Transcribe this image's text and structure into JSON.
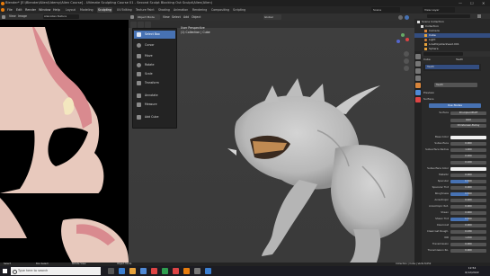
{
  "window": {
    "title": "Blender* [E:\\Blender\\Alien\\Udemy\\Alien Course] - Ultimate Sculpting Course 01 - Second Sculpt Blocking Out Sculpt\\Alien(Alien)",
    "controls": [
      "—",
      "☐",
      "✕"
    ]
  },
  "menubar": {
    "items": [
      "File",
      "Edit",
      "Render",
      "Window",
      "Help"
    ],
    "workspaces": [
      "Layout",
      "Modeling",
      "Sculpting",
      "UV Editing",
      "Texture Paint",
      "Shading",
      "Animation",
      "Rendering",
      "Compositing",
      "Scripting"
    ],
    "active_workspace": "Sculpting",
    "scene": "Scene",
    "view_layer": "View Layer"
  },
  "image_editor": {
    "header_items": [
      "View",
      "Image"
    ],
    "image_name": "AlienAlien.Texture"
  },
  "viewport": {
    "header": {
      "mode": "Object Mode",
      "menus": [
        "View",
        "Select",
        "Add",
        "Object"
      ],
      "transform": "Global"
    },
    "overlay_text": {
      "line1": "User Perspective",
      "line2": "(1) Collection | Cube"
    },
    "tools": [
      {
        "label": "Select Box",
        "icon": "select-box-icon",
        "active": true
      },
      {
        "label": "Cursor",
        "icon": "cursor-icon",
        "active": false
      },
      {
        "label": "Move",
        "icon": "move-icon",
        "active": false
      },
      {
        "label": "Rotate",
        "icon": "rotate-icon",
        "active": false
      },
      {
        "label": "Scale",
        "icon": "scale-icon",
        "active": false
      },
      {
        "label": "Transform",
        "icon": "transform-icon",
        "active": false
      },
      {
        "label": "Annotate",
        "icon": "annotate-icon",
        "active": false
      },
      {
        "label": "Measure",
        "icon": "measure-icon",
        "active": false
      },
      {
        "label": "Add Cube",
        "icon": "add-cube-icon",
        "active": false
      }
    ]
  },
  "outliner": {
    "search_placeholder": "",
    "rows": [
      {
        "label": "Scene Collection",
        "selected": false
      },
      {
        "label": "Collection",
        "selected": false
      },
      {
        "label": "Camera",
        "selected": false
      },
      {
        "label": "Cube",
        "selected": true
      },
      {
        "label": "Light",
        "selected": false
      },
      {
        "label": "LowPolyAlienhead.001",
        "selected": false
      },
      {
        "label": "Sphere",
        "selected": false
      }
    ]
  },
  "properties": {
    "object_name": "Cube",
    "material_name": "Teeth",
    "surface_button": "Use Nodes",
    "panels": {
      "preview": "Preview",
      "surface": "Surface"
    },
    "surface_label": "Surface",
    "surface_value": "Principled BSDF",
    "distribution": "GGX",
    "subsurface_method": "Christensen-Burley",
    "rows": [
      {
        "label": "Base Color",
        "value": "",
        "kind": "swatch"
      },
      {
        "label": "Subsurface",
        "value": "0.000",
        "kind": "num"
      },
      {
        "label": "Subsurface Radius",
        "value": "1.000",
        "kind": "num"
      },
      {
        "label": "",
        "value": "0.200",
        "kind": "num"
      },
      {
        "label": "",
        "value": "0.100",
        "kind": "num"
      },
      {
        "label": "Subsurface Color",
        "value": "",
        "kind": "swatch"
      },
      {
        "label": "Metallic",
        "value": "0.000",
        "kind": "num"
      },
      {
        "label": "Specular",
        "value": "0.500",
        "kind": "fill",
        "fill": 0.5
      },
      {
        "label": "Specular Tint",
        "value": "0.000",
        "kind": "num"
      },
      {
        "label": "Roughness",
        "value": "0.500",
        "kind": "fill",
        "fill": 0.5
      },
      {
        "label": "Anisotropic",
        "value": "0.000",
        "kind": "num"
      },
      {
        "label": "Anisotropic Rot.",
        "value": "0.000",
        "kind": "num"
      },
      {
        "label": "Sheen",
        "value": "0.000",
        "kind": "num"
      },
      {
        "label": "Sheen Tint",
        "value": "0.500",
        "kind": "fill",
        "fill": 0.5
      },
      {
        "label": "Clearcoat",
        "value": "0.000",
        "kind": "num"
      },
      {
        "label": "Clearcoat Rough.",
        "value": "0.030",
        "kind": "num"
      },
      {
        "label": "IOR",
        "value": "1.450",
        "kind": "num"
      },
      {
        "label": "Transmission",
        "value": "0.000",
        "kind": "num"
      },
      {
        "label": "Transmission Ro.",
        "value": "0.000",
        "kind": "num"
      }
    ]
  },
  "statusbar": {
    "left": "Select",
    "middle": "Box Select",
    "mid2": "Rotate View",
    "right": "Object Mode",
    "version": "Collection | Cube | Verts 8,052"
  },
  "taskbar": {
    "search_placeholder": "Type here to search",
    "clock": "12:54",
    "date": "6/12/2022"
  },
  "colors": {
    "accent": "#4772b3",
    "active_tab": "#3d3d3d",
    "selection": "#334d80"
  }
}
